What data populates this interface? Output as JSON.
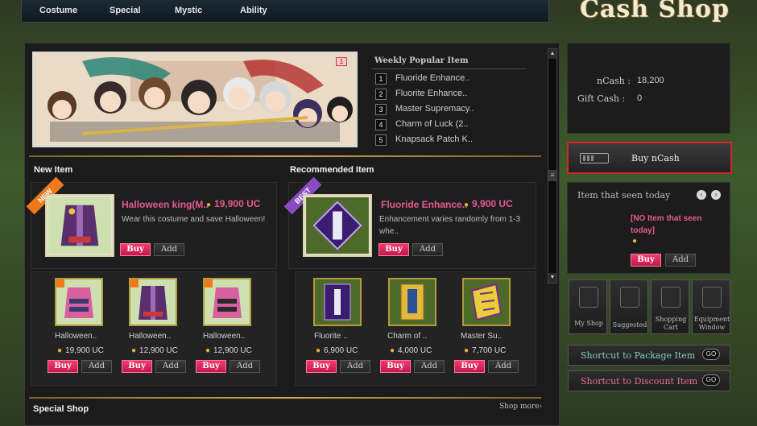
{
  "top_tabs": [
    "Costume",
    "Special",
    "Mystic",
    "Ability"
  ],
  "title": "Cash Shop",
  "banner": {
    "badge": "1"
  },
  "weekly": {
    "title": "Weekly Popular Item",
    "items": [
      {
        "rank": "1",
        "name": "Fluoride Enhance.."
      },
      {
        "rank": "2",
        "name": "Fluorite Enhance.."
      },
      {
        "rank": "3",
        "name": "Master Supremacy.."
      },
      {
        "rank": "4",
        "name": "Charm of Luck (2.."
      },
      {
        "rank": "5",
        "name": "Knapsack Patch K.."
      }
    ]
  },
  "new_item": {
    "title": "New Item",
    "ribbon": "NEW",
    "featured": {
      "name": "Halloween king(M..",
      "price": "19,900 UC",
      "desc": "Wear this costume and save Halloween!",
      "buy": "Buy",
      "add": "Add"
    },
    "items": [
      {
        "name": "Halloween..",
        "price": "19,900 UC",
        "buy": "Buy",
        "add": "Add"
      },
      {
        "name": "Halloween..",
        "price": "12,900 UC",
        "buy": "Buy",
        "add": "Add"
      },
      {
        "name": "Halloween..",
        "price": "12,900 UC",
        "buy": "Buy",
        "add": "Add"
      }
    ]
  },
  "recommended": {
    "title": "Recommended Item",
    "ribbon": "BEST",
    "featured": {
      "name": "Fluoride Enhance..",
      "price": "9,900 UC",
      "desc1": "Enhancement varies randomly from 1-3",
      "desc2": "whe..",
      "buy": "Buy",
      "add": "Add"
    },
    "items": [
      {
        "name": "Fluorite ..",
        "price": "6,900 UC",
        "buy": "Buy",
        "add": "Add"
      },
      {
        "name": "Charm of ..",
        "price": "4,000 UC",
        "buy": "Buy",
        "add": "Add"
      },
      {
        "name": "Master Su..",
        "price": "7,700 UC",
        "buy": "Buy",
        "add": "Add"
      }
    ]
  },
  "special_shop": {
    "title": "Special Shop",
    "more": "Shop more›"
  },
  "account": {
    "ncash_label": "nCash :",
    "ncash_value": "18,200",
    "gift_label": "Gift Cash :",
    "gift_value": "0"
  },
  "buy_ncash": "Buy nCash",
  "seen_today": {
    "title": "Item that seen today",
    "empty": "[NO Item that seen today]",
    "buy": "Buy",
    "add": "Add"
  },
  "quick_buttons": [
    {
      "label1": "My Shop",
      "label2": ""
    },
    {
      "label1": "Suggested",
      "label2": ""
    },
    {
      "label1": "Shopping",
      "label2": "Cart"
    },
    {
      "label1": "Equipment",
      "label2": "Window"
    }
  ],
  "shortcuts": [
    {
      "label": "Shortcut to Package Item",
      "go": "GO"
    },
    {
      "label": "Shortcut to Discount Item",
      "go": "GO"
    }
  ],
  "colors": {
    "accent_pink": "#e85a92",
    "buy_button": "#e02a5e",
    "highlight_border": "#d0262c",
    "gold": "#c9a84d"
  }
}
